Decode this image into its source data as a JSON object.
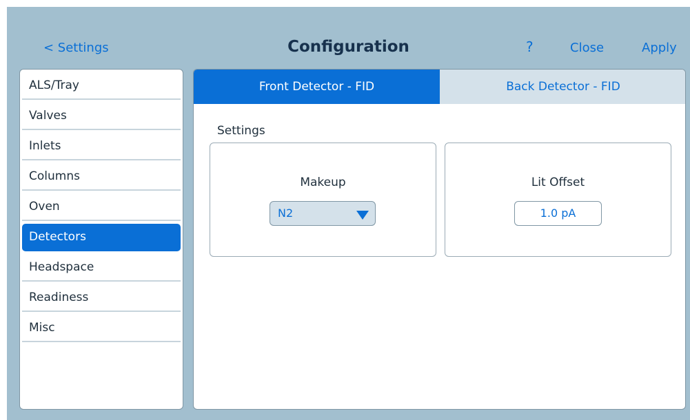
{
  "header": {
    "back_label": "< Settings",
    "title": "Configuration",
    "help_label": "?",
    "close_label": "Close",
    "apply_label": "Apply"
  },
  "sidebar": {
    "items": [
      {
        "label": "ALS/Tray"
      },
      {
        "label": "Valves"
      },
      {
        "label": "Inlets"
      },
      {
        "label": "Columns"
      },
      {
        "label": "Oven"
      },
      {
        "label": "Detectors",
        "selected": true
      },
      {
        "label": "Headspace"
      },
      {
        "label": "Readiness"
      },
      {
        "label": "Misc"
      }
    ]
  },
  "main": {
    "tabs": [
      {
        "label": "Front Detector - FID",
        "selected": true
      },
      {
        "label": "Back Detector - FID",
        "selected": false
      }
    ],
    "section_label": "Settings",
    "makeup": {
      "label": "Makeup",
      "value": "N2"
    },
    "lit_offset": {
      "label": "Lit Offset",
      "value": "1.0 pA"
    }
  },
  "colors": {
    "accent": "#0a6fd6",
    "background": "#a2bfcf",
    "tab_inactive": "#d4e1ea",
    "title_text": "#17314d"
  },
  "icons": {
    "dropdown_caret": "chevron-down-icon"
  }
}
